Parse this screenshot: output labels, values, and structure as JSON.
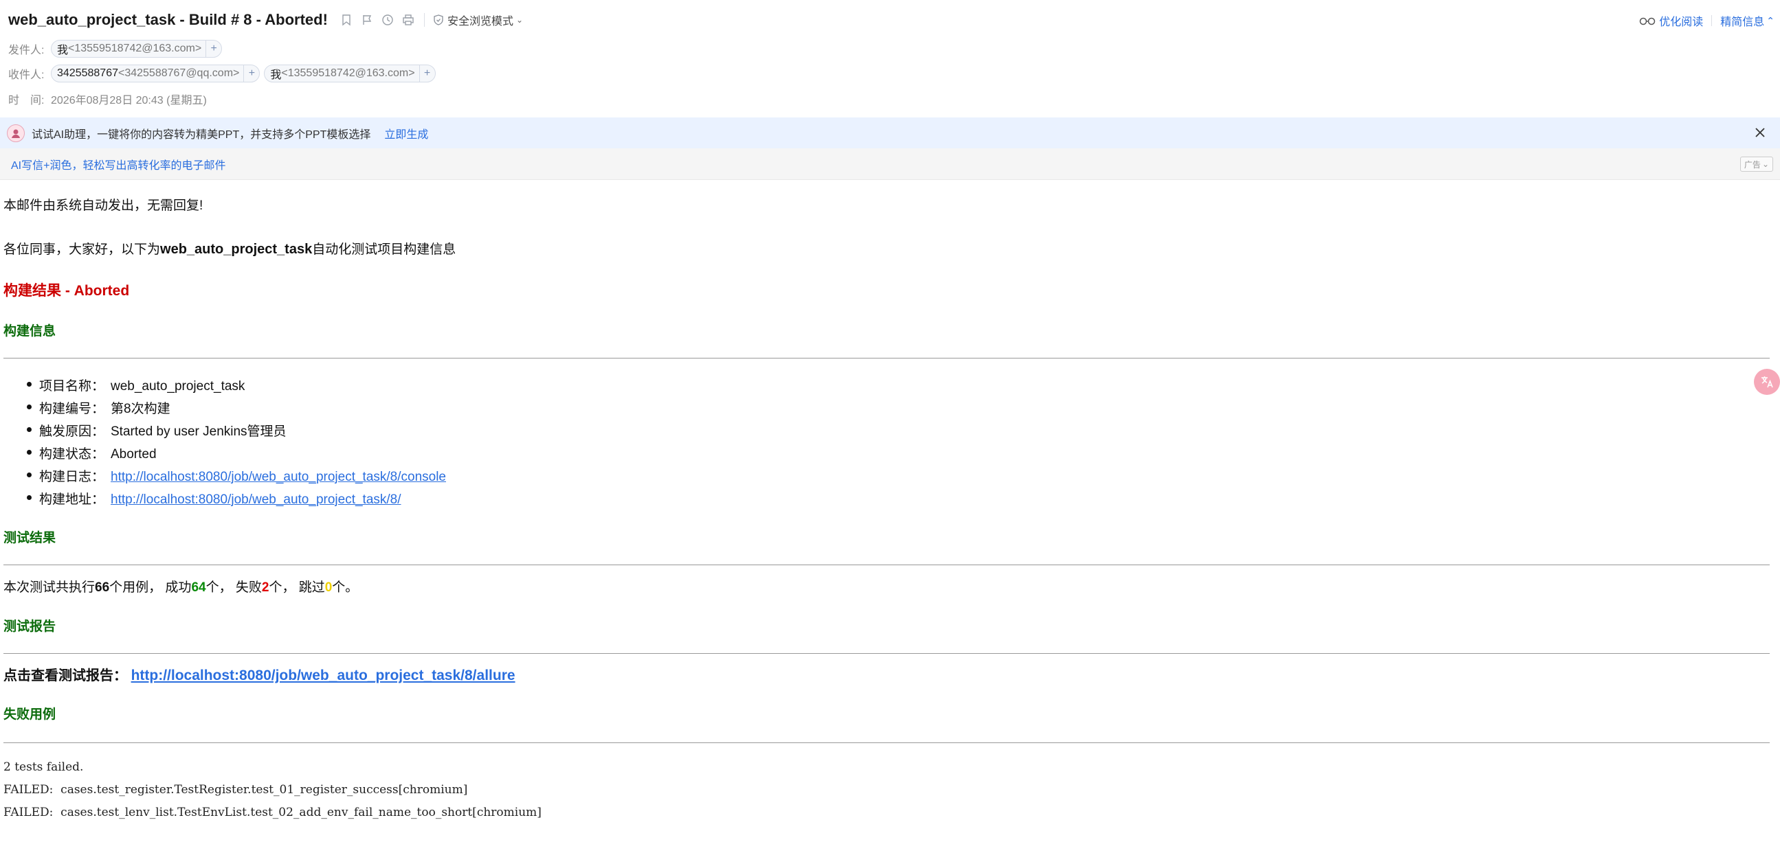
{
  "header": {
    "subject": "web_auto_project_task - Build # 8 - Aborted!",
    "safe_mode_label": "安全浏览模式",
    "optimize_read_label": "优化阅读",
    "brief_info_label": "精简信息",
    "sender_label": "发件人:",
    "sender": {
      "name": "我",
      "address": "<13559518742@163.com>"
    },
    "recipient_label": "收件人:",
    "recipients": [
      {
        "name": "3425588767",
        "address": "<3425588767@qq.com>"
      },
      {
        "name": "我",
        "address": "<13559518742@163.com>"
      }
    ],
    "time_label": "时　间:",
    "time_value": "2026年08月28日 20:43 (星期五)",
    "plus_symbol": "+",
    "icons": [
      "bookmark-icon",
      "flag-icon",
      "clock-icon",
      "print-icon",
      "shield-icon",
      "glasses-icon",
      "chevron-up-icon"
    ]
  },
  "ai_banner": {
    "text": "试试AI助理，一键将你的内容转为精美PPT，并支持多个PPT模板选择",
    "link": "立即生成"
  },
  "ad_banner": {
    "text": "AI写信+润色，轻松写出高转化率的电子邮件",
    "badge": "广告"
  },
  "body": {
    "auto_notice": "本邮件由系统自动发出，无需回复!",
    "greeting_prefix": "各位同事，大家好，以下为",
    "greeting_project": "web_auto_project_task",
    "greeting_suffix": "自动化测试项目构建信息",
    "build_result": "构建结果 - Aborted",
    "build_info_heading": "构建信息",
    "info_items": [
      {
        "key": "项目名称：",
        "value": "web_auto_project_task",
        "is_link": false
      },
      {
        "key": "构建编号：",
        "value": "第8次构建",
        "is_link": false
      },
      {
        "key": "触发原因：",
        "value": "Started by user Jenkins管理员",
        "is_link": false
      },
      {
        "key": "构建状态：",
        "value": "Aborted",
        "is_link": false
      },
      {
        "key": "构建日志：",
        "value": "http://localhost:8080/job/web_auto_project_task/8/console",
        "is_link": true
      },
      {
        "key": "构建地址：",
        "value": "http://localhost:8080/job/web_auto_project_task/8/",
        "is_link": true
      }
    ],
    "test_result_heading": "测试结果",
    "summary": {
      "p1": "本次测试共执行",
      "total": "66",
      "p2": "个用例，  成功",
      "passed": "64",
      "p3": "个，  失败",
      "failed": "2",
      "p4": "个，  跳过",
      "skipped": "0",
      "p5": "个。"
    },
    "test_report_heading": "测试报告",
    "report_label": "点击查看测试报告：",
    "report_link": "http://localhost:8080/job/web_auto_project_task/8/allure",
    "failed_cases_heading": "失败用例",
    "failed_lines": [
      "2 tests failed.",
      "FAILED:  cases.test_register.TestRegister.test_01_register_success[chromium]",
      "FAILED:  cases.test_lenv_list.TestEnvList.test_02_add_env_fail_name_too_short[chromium]"
    ]
  },
  "colors": {
    "link_blue": "#2a6ede",
    "heading_green": "#0b6b0b",
    "result_red": "#cc0000",
    "passed_green": "#0a8a0a",
    "failed_red": "#e00000",
    "skipped_yellow": "#f0d000",
    "ai_banner_bg": "#eaf2ff"
  }
}
